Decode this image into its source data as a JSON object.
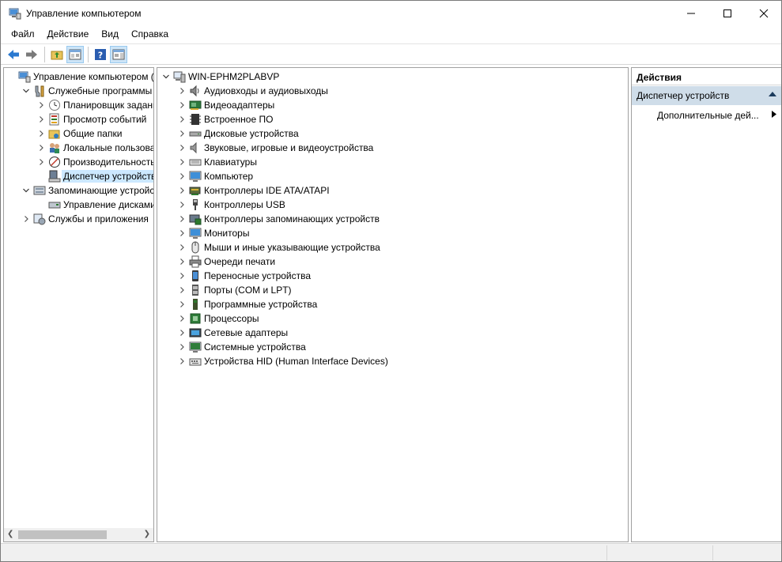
{
  "window": {
    "title": "Управление компьютером"
  },
  "menu": [
    "Файл",
    "Действие",
    "Вид",
    "Справка"
  ],
  "left_tree": [
    {
      "label": "Управление компьютером (л",
      "icon": "computer-management-icon",
      "chevron": "",
      "indent": 0
    },
    {
      "label": "Служебные программы",
      "icon": "tools-icon",
      "chevron": "down",
      "indent": 1
    },
    {
      "label": "Планировщик заданий",
      "icon": "clock-icon",
      "chevron": "right",
      "indent": 2
    },
    {
      "label": "Просмотр событий",
      "icon": "event-viewer-icon",
      "chevron": "right",
      "indent": 2
    },
    {
      "label": "Общие папки",
      "icon": "shared-folders-icon",
      "chevron": "right",
      "indent": 2
    },
    {
      "label": "Локальные пользовате",
      "icon": "users-icon",
      "chevron": "right",
      "indent": 2
    },
    {
      "label": "Производительность",
      "icon": "performance-icon",
      "chevron": "right",
      "indent": 2
    },
    {
      "label": "Диспетчер устройств",
      "icon": "device-manager-icon",
      "chevron": "",
      "indent": 2,
      "selected": true
    },
    {
      "label": "Запоминающие устройст",
      "icon": "storage-icon",
      "chevron": "down",
      "indent": 1
    },
    {
      "label": "Управление дисками",
      "icon": "disk-management-icon",
      "chevron": "",
      "indent": 2
    },
    {
      "label": "Службы и приложения",
      "icon": "services-icon",
      "chevron": "right",
      "indent": 1
    }
  ],
  "device_tree": {
    "root": "WIN-EPHM2PLABVP",
    "items": [
      {
        "label": "Аудиовходы и аудиовыходы",
        "icon": "speaker-icon"
      },
      {
        "label": "Видеоадаптеры",
        "icon": "display-adapter-icon"
      },
      {
        "label": "Встроенное ПО",
        "icon": "firmware-icon"
      },
      {
        "label": "Дисковые устройства",
        "icon": "disk-drive-icon"
      },
      {
        "label": "Звуковые, игровые и видеоустройства",
        "icon": "sound-icon"
      },
      {
        "label": "Клавиатуры",
        "icon": "keyboard-icon"
      },
      {
        "label": "Компьютер",
        "icon": "monitor-icon"
      },
      {
        "label": "Контроллеры IDE ATA/ATAPI",
        "icon": "ide-controller-icon"
      },
      {
        "label": "Контроллеры USB",
        "icon": "usb-icon"
      },
      {
        "label": "Контроллеры запоминающих устройств",
        "icon": "storage-controller-icon"
      },
      {
        "label": "Мониторы",
        "icon": "monitor-icon"
      },
      {
        "label": "Мыши и иные указывающие устройства",
        "icon": "mouse-icon"
      },
      {
        "label": "Очереди печати",
        "icon": "printer-icon"
      },
      {
        "label": "Переносные устройства",
        "icon": "portable-device-icon"
      },
      {
        "label": "Порты (COM и LPT)",
        "icon": "port-icon"
      },
      {
        "label": "Программные устройства",
        "icon": "software-device-icon"
      },
      {
        "label": "Процессоры",
        "icon": "processor-icon"
      },
      {
        "label": "Сетевые адаптеры",
        "icon": "network-adapter-icon"
      },
      {
        "label": "Системные устройства",
        "icon": "system-device-icon"
      },
      {
        "label": "Устройства HID (Human Interface Devices)",
        "icon": "hid-icon"
      }
    ]
  },
  "actions": {
    "header": "Действия",
    "section": "Диспетчер устройств",
    "more": "Дополнительные дей..."
  }
}
